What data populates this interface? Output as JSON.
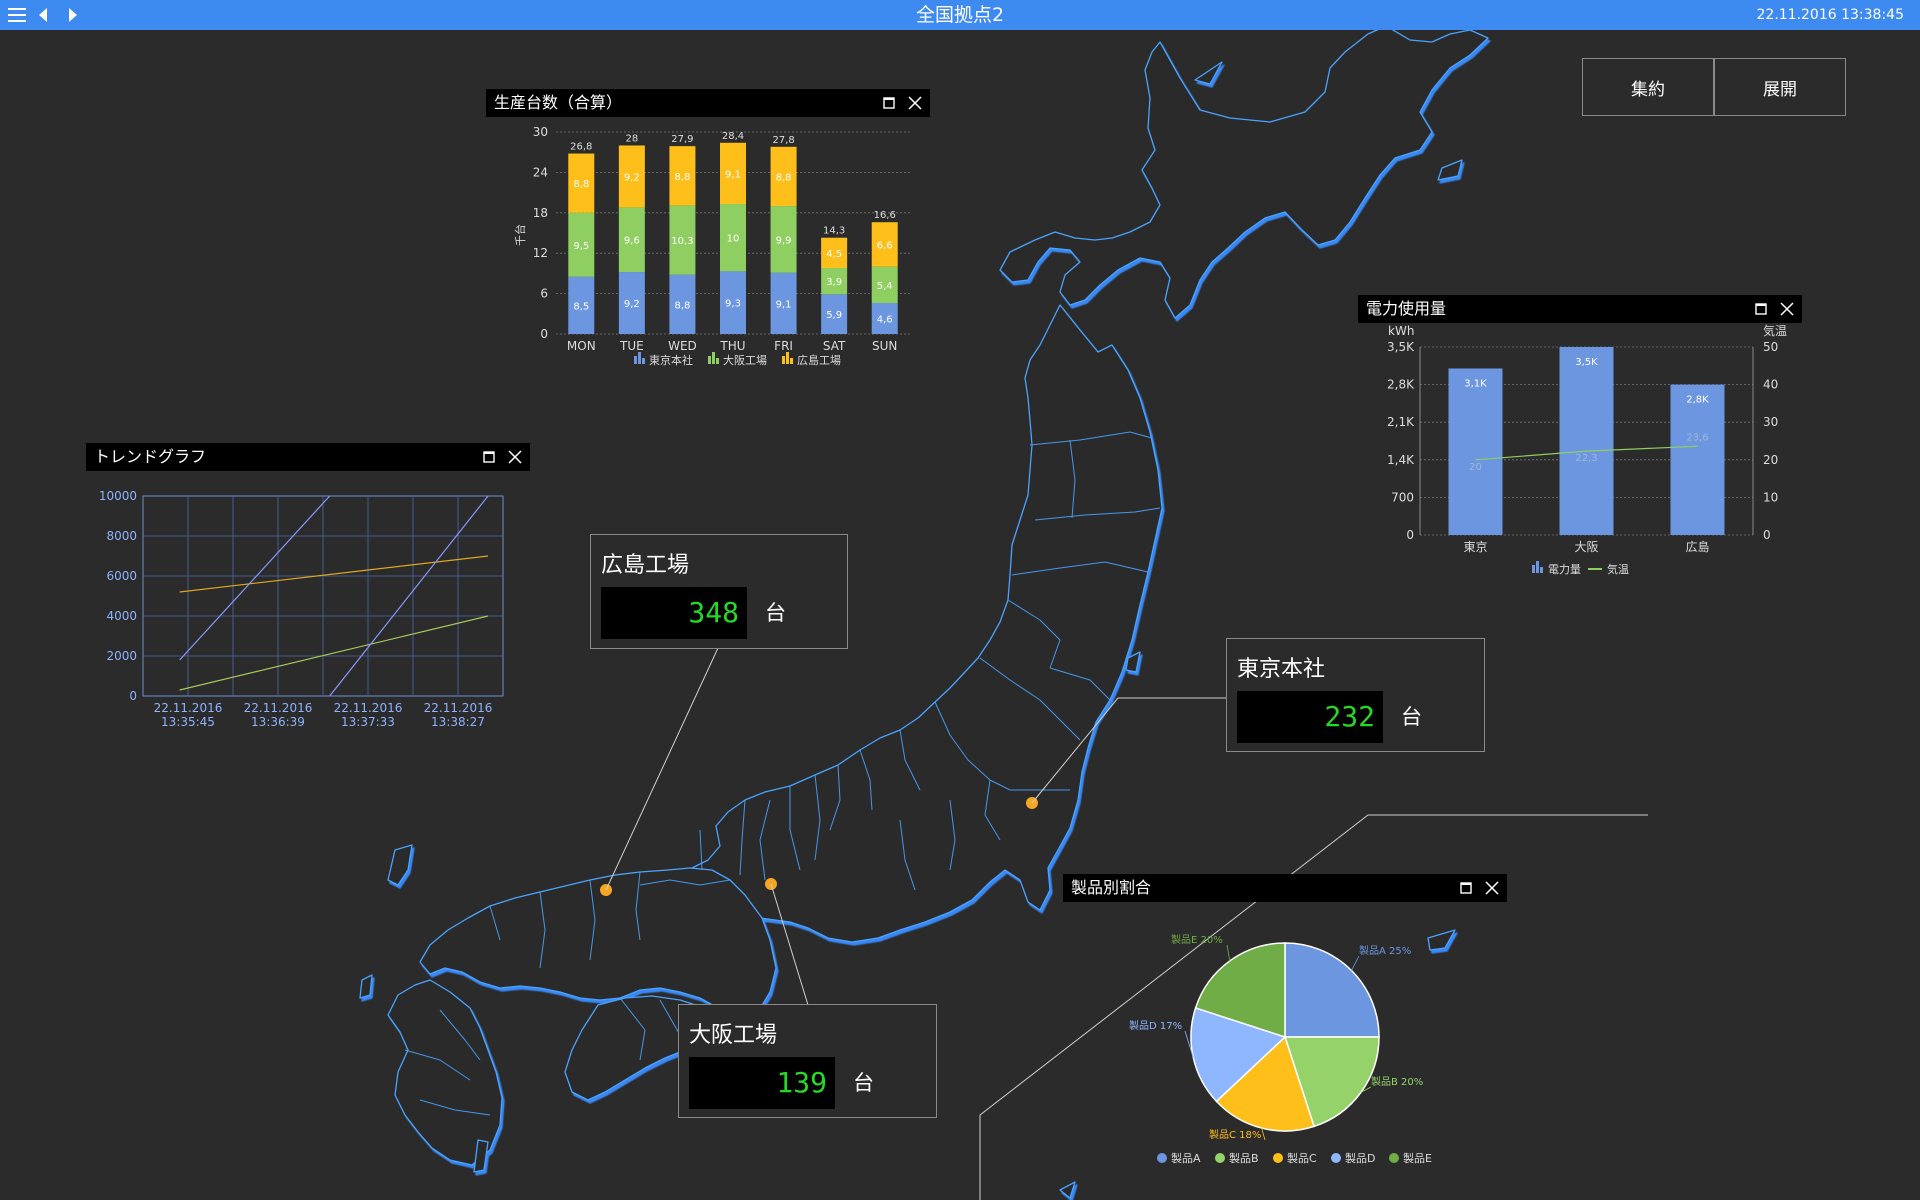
{
  "header": {
    "title": "全国拠点2",
    "datetime": "22.11.2016 13:38:45",
    "bg_color": "#3d8af0"
  },
  "toolbar": {
    "collapse_label": "集約",
    "expand_label": "展開"
  },
  "sites": {
    "hiroshima": {
      "name": "広島工場",
      "value": "348",
      "unit": "台"
    },
    "tokyo": {
      "name": "東京本社",
      "value": "232",
      "unit": "台"
    },
    "osaka": {
      "name": "大阪工場",
      "value": "139",
      "unit": "台"
    }
  },
  "colors": {
    "tokyo": "#6c96e0",
    "osaka": "#8fcf61",
    "hiroshima": "#ffbf1a",
    "marker": "#f5a623",
    "value_text": "#26d926",
    "map_line": "#4aa3ff"
  },
  "panels": {
    "production": {
      "title": "生産台数（合算）"
    },
    "trend": {
      "title": "トレンドグラフ"
    },
    "power": {
      "title": "電力使用量"
    },
    "pie": {
      "title": "製品別割合"
    }
  },
  "chart_data": [
    {
      "id": "production",
      "type": "bar",
      "stacked": true,
      "title": "生産台数（合算）",
      "ylabel": "千台",
      "ylim": [
        0,
        30
      ],
      "yticks": [
        "0",
        "6",
        "12",
        "18",
        "24",
        "30"
      ],
      "categories": [
        "MON",
        "TUE",
        "WED",
        "THU",
        "FRI",
        "SAT",
        "SUN"
      ],
      "totals": [
        "26,8",
        "28",
        "27,9",
        "28,4",
        "27,8",
        "14,3",
        "16,6"
      ],
      "series": [
        {
          "name": "東京本社",
          "color": "#6c96e0",
          "values": [
            8.5,
            9.2,
            8.8,
            9.3,
            9.1,
            5.9,
            4.6
          ],
          "labels": [
            "8,5",
            "9,2",
            "8,8",
            "9,3",
            "9,1",
            "5,9",
            "4,6"
          ]
        },
        {
          "name": "大阪工場",
          "color": "#8fcf61",
          "values": [
            9.5,
            9.6,
            10.3,
            10,
            9.9,
            3.9,
            5.4
          ],
          "labels": [
            "9,5",
            "9,6",
            "10,3",
            "10",
            "9,9",
            "3,9",
            "5,4"
          ]
        },
        {
          "name": "広島工場",
          "color": "#ffbf1a",
          "values": [
            8.8,
            9.2,
            8.8,
            9.1,
            8.8,
            4.5,
            6.6
          ],
          "labels": [
            "8,8",
            "9,2",
            "8,8",
            "9,1",
            "8,8",
            "4,5",
            "6,6"
          ]
        }
      ],
      "grid": true,
      "legend": "bottom"
    },
    {
      "id": "trend",
      "type": "line",
      "ylim": [
        0,
        10000
      ],
      "yticks": [
        "0",
        "2000",
        "4000",
        "6000",
        "8000",
        "10000"
      ],
      "xticks": [
        {
          "date": "22.11.2016",
          "time": "13:35:45"
        },
        {
          "date": "22.11.2016",
          "time": "13:36:39"
        },
        {
          "date": "22.11.2016",
          "time": "13:37:33"
        },
        {
          "date": "22.11.2016",
          "time": "13:38:27"
        }
      ],
      "series": [
        {
          "color": "#e0a820",
          "points": [
            [
              "13:35:40",
              5200
            ],
            [
              "13:38:45",
              7000
            ]
          ]
        },
        {
          "color": "#a6c85a",
          "points": [
            [
              "13:35:40",
              300
            ],
            [
              "13:38:45",
              4000
            ]
          ]
        },
        {
          "color": "#8a98ff",
          "points": [
            [
              "13:35:40",
              1800
            ],
            [
              "13:37:10",
              10000
            ]
          ]
        },
        {
          "color": "#8a98ff",
          "points": [
            [
              "13:37:10",
              0
            ],
            [
              "13:38:45",
              10000
            ]
          ]
        }
      ],
      "grid": true
    },
    {
      "id": "power",
      "type": "bar",
      "title": "電力使用量",
      "ylabel": "kWh",
      "y2label": "気温",
      "ylim": [
        0,
        3500
      ],
      "yticks": [
        "0",
        "700",
        "1,4K",
        "2,1K",
        "2,8K",
        "3,5K"
      ],
      "y2lim": [
        0,
        50
      ],
      "y2ticks": [
        "0",
        "10",
        "20",
        "30",
        "40",
        "50"
      ],
      "categories": [
        "東京",
        "大阪",
        "広島"
      ],
      "series": [
        {
          "name": "電力量",
          "type": "bar",
          "color": "#6c96e0",
          "values": [
            3100,
            3500,
            2800
          ],
          "labels": [
            "3,1K",
            "3,5K",
            "2,8K"
          ]
        },
        {
          "name": "気温",
          "type": "line",
          "color": "#8fcf61",
          "axis": "y2",
          "values": [
            20,
            22.3,
            23.6
          ],
          "labels": [
            "20",
            "22,3",
            "23,6"
          ]
        }
      ],
      "grid": true,
      "legend": "bottom"
    },
    {
      "id": "pie",
      "type": "pie",
      "title": "製品別割合",
      "slices": [
        {
          "name": "製品A",
          "value": 25,
          "color": "#6c96e0",
          "label": "製品A 25%"
        },
        {
          "name": "製品B",
          "value": 20,
          "color": "#96d26a",
          "label": "製品B 20%"
        },
        {
          "name": "製品C",
          "value": 18,
          "color": "#ffbf1a",
          "label": "製品C 18%"
        },
        {
          "name": "製品D",
          "value": 17,
          "color": "#8fb7ff",
          "label": "製品D 17%"
        },
        {
          "name": "製品E",
          "value": 20,
          "color": "#70ad47",
          "label": "製品E 20%"
        }
      ],
      "legend": "bottom"
    }
  ]
}
